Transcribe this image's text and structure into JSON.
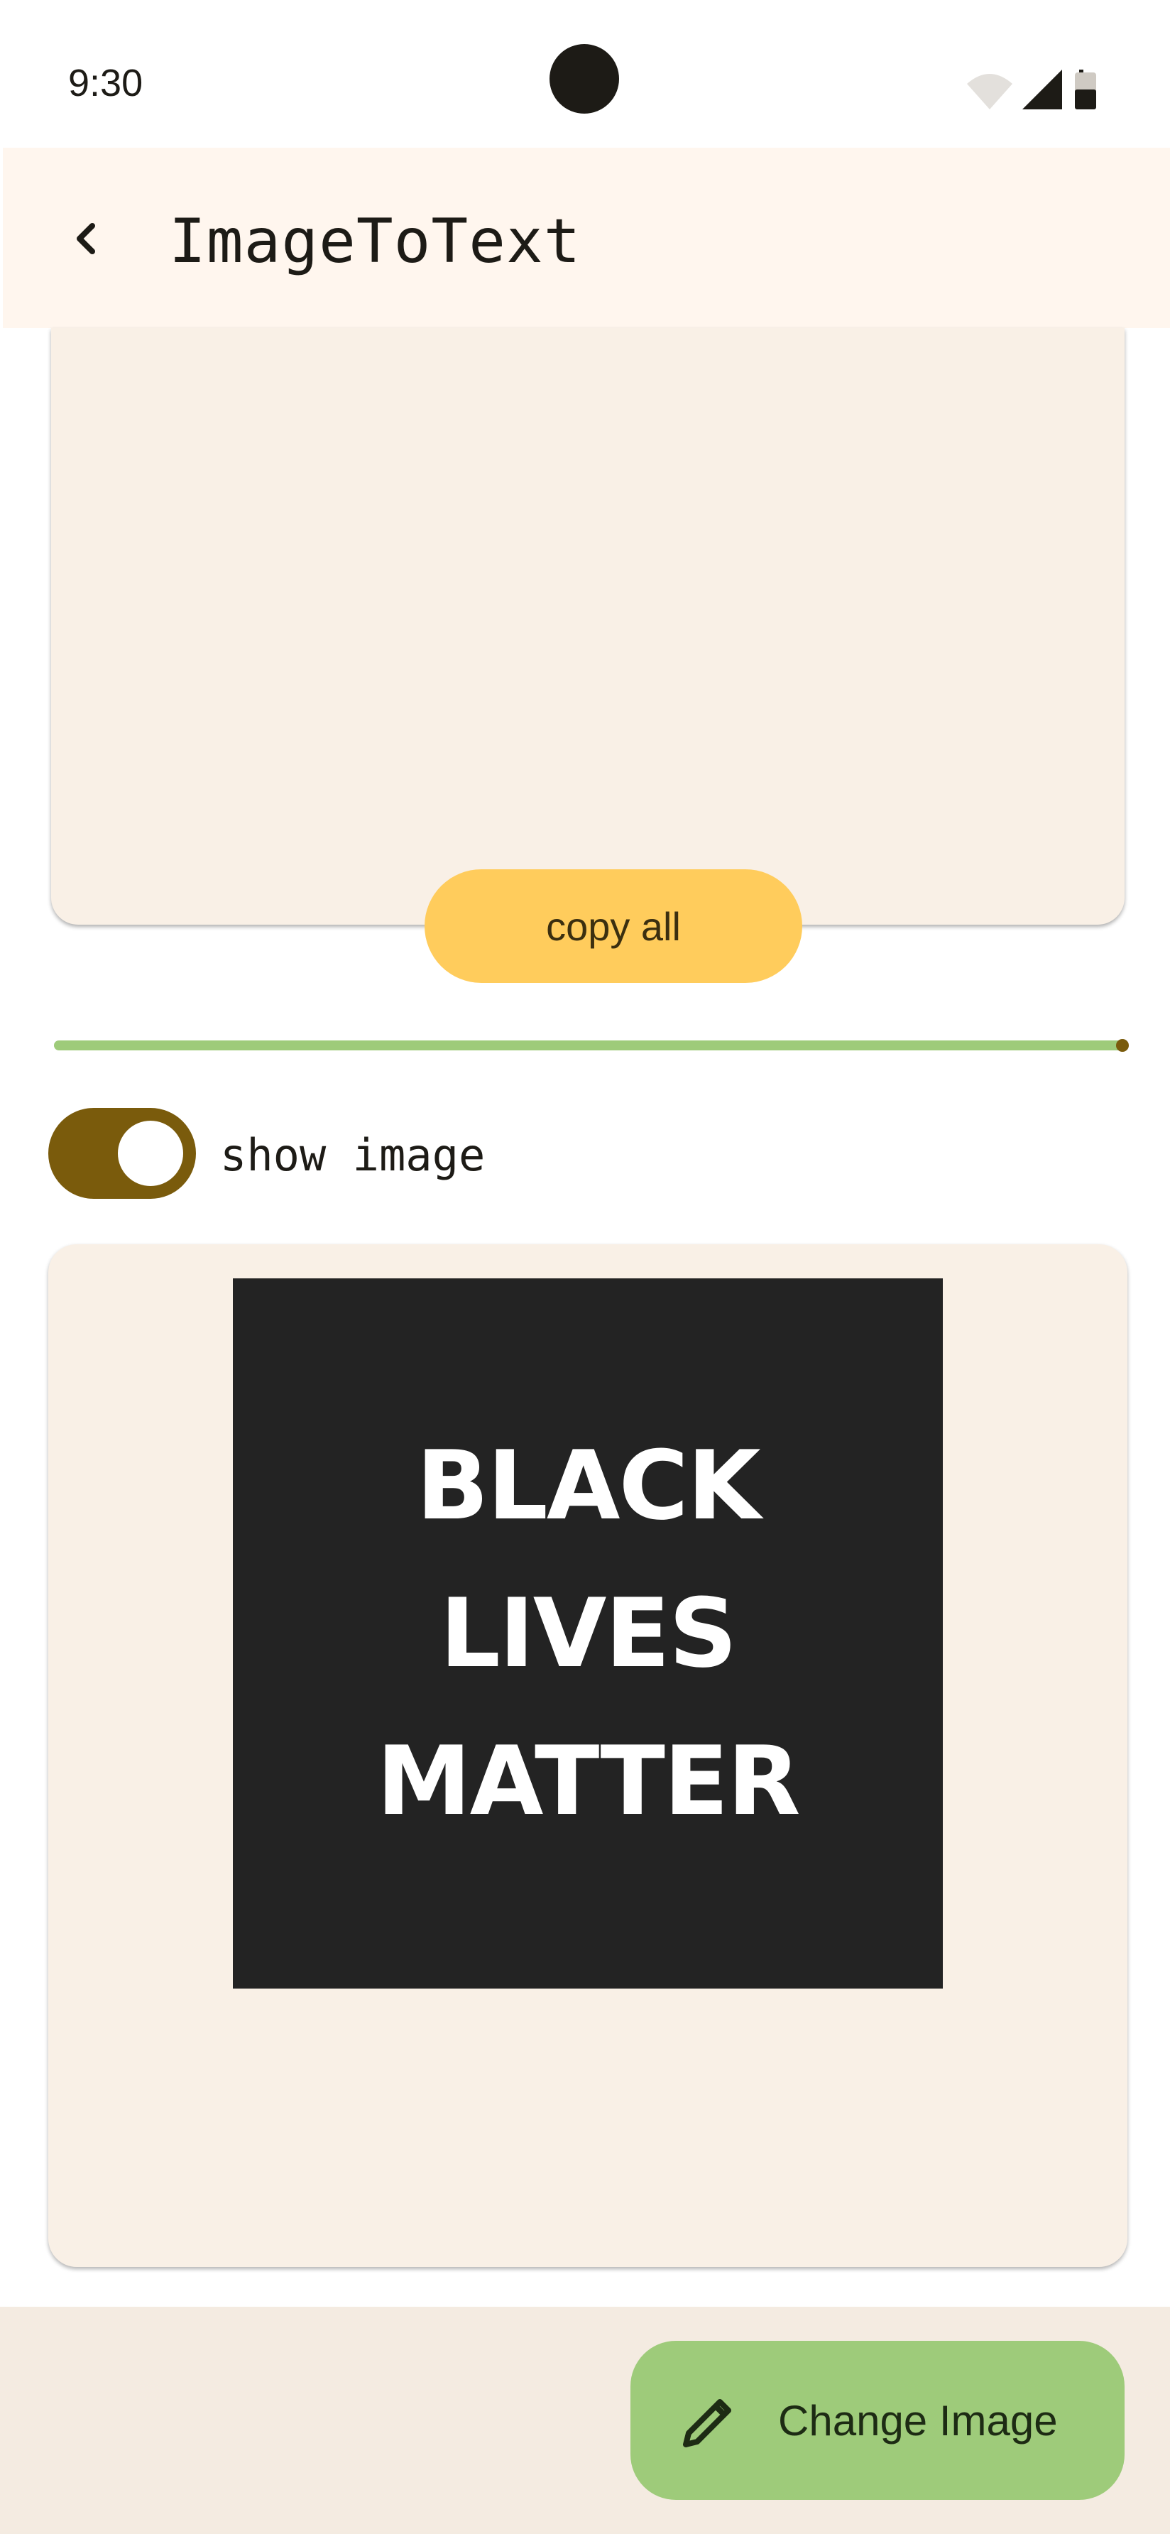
{
  "status_bar": {
    "time": "9:30",
    "icons": [
      "wifi-icon",
      "cell-signal-icon",
      "battery-icon"
    ]
  },
  "app_bar": {
    "back_icon": "chevron-left-icon",
    "title": "ImageToText"
  },
  "text_result": {
    "copy_label": "copy all"
  },
  "progress": {
    "value": 1.0
  },
  "image_toggle": {
    "label": "show image",
    "checked": true
  },
  "image_preview": {
    "lines": [
      "BLACK",
      "LIVES",
      "MATTER"
    ]
  },
  "action": {
    "icon": "pencil-icon",
    "label": "Change Image"
  },
  "colors": {
    "primary": "#7a5b0c",
    "accent_yellow": "#ffcc5c",
    "accent_green": "#9ecb7a",
    "surface": "#f9f0e6",
    "app_bar": "#fff6ee"
  }
}
